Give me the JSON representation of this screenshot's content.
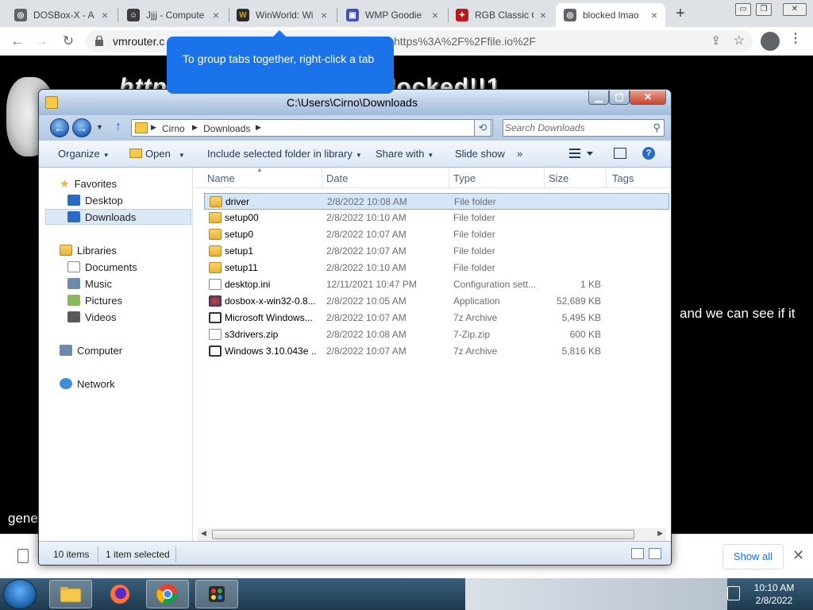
{
  "chrome": {
    "tabs": [
      {
        "title": "DOSBox-X - A",
        "fav_color": "#5f6368",
        "fav_glyph": "◎"
      },
      {
        "title": "Jjjj - Compute",
        "fav_color": "#3c3c3c",
        "fav_glyph": "☺"
      },
      {
        "title": "WinWorld: Wi",
        "fav_color": "#2b2b2b",
        "fav_glyph": "W"
      },
      {
        "title": "WMP Goodie",
        "fav_color": "#3f51b5",
        "fav_glyph": "▣"
      },
      {
        "title": "RGB Classic G",
        "fav_color": "#b71c1c",
        "fav_glyph": "✦"
      },
      {
        "title": "blocked lmao",
        "fav_color": "#5f6368",
        "fav_glyph": "◎"
      }
    ],
    "new_tab": "+",
    "window_controls": [
      "▭",
      "❐",
      "✕"
    ],
    "url_left": "vmrouter.c",
    "url_right": "https%3A%2F%2Ffile.io%2F",
    "tooltip": "To group tabs together, right-click a tab"
  },
  "page": {
    "title_left": "http",
    "title_right": "locked!!1",
    "text_right": "and we can see if it",
    "text_left": "gene"
  },
  "downloads_bar": {
    "show_all": "Show all",
    "close": "✕"
  },
  "explorer": {
    "title": "C:\\Users\\Cirno\\Downloads",
    "path": [
      "Cirno",
      "Downloads"
    ],
    "search_placeholder": "Search Downloads",
    "commands": {
      "organize": "Organize",
      "open": "Open",
      "include": "Include selected folder in library",
      "share": "Share with",
      "slideshow": "Slide show",
      "more": "»"
    },
    "nav": {
      "favorites": "Favorites",
      "desktop": "Desktop",
      "downloads": "Downloads",
      "libraries": "Libraries",
      "documents": "Documents",
      "music": "Music",
      "pictures": "Pictures",
      "videos": "Videos",
      "computer": "Computer",
      "network": "Network"
    },
    "columns": {
      "name": "Name",
      "date": "Date",
      "type": "Type",
      "size": "Size",
      "tags": "Tags"
    },
    "files": [
      {
        "name": "driver",
        "date": "2/8/2022 10:08 AM",
        "type": "File folder",
        "size": "",
        "icon": "folder"
      },
      {
        "name": "setup00",
        "date": "2/8/2022 10:10 AM",
        "type": "File folder",
        "size": "",
        "icon": "folder"
      },
      {
        "name": "setup0",
        "date": "2/8/2022 10:07 AM",
        "type": "File folder",
        "size": "",
        "icon": "folder"
      },
      {
        "name": "setup1",
        "date": "2/8/2022 10:07 AM",
        "type": "File folder",
        "size": "",
        "icon": "folder"
      },
      {
        "name": "setup11",
        "date": "2/8/2022 10:10 AM",
        "type": "File folder",
        "size": "",
        "icon": "folder"
      },
      {
        "name": "desktop.ini",
        "date": "12/11/2021 10:47 PM",
        "type": "Configuration sett...",
        "size": "1 KB",
        "icon": "doc"
      },
      {
        "name": "dosbox-x-win32-0.8...",
        "date": "2/8/2022 10:05 AM",
        "type": "Application",
        "size": "52,689 KB",
        "icon": "app"
      },
      {
        "name": "Microsoft Windows...",
        "date": "2/8/2022 10:07 AM",
        "type": "7z Archive",
        "size": "5,495 KB",
        "icon": "zip"
      },
      {
        "name": "s3drivers.zip",
        "date": "2/8/2022 10:08 AM",
        "type": "7-Zip.zip",
        "size": "600 KB",
        "icon": "doc"
      },
      {
        "name": "Windows 3.10.043e ...",
        "date": "2/8/2022 10:07 AM",
        "type": "7z Archive",
        "size": "5,816 KB",
        "icon": "zip"
      }
    ],
    "status": {
      "items": "10 items",
      "selected": "1 item selected"
    }
  },
  "taskbar": {
    "time": "10:10 AM",
    "date": "2/8/2022"
  }
}
